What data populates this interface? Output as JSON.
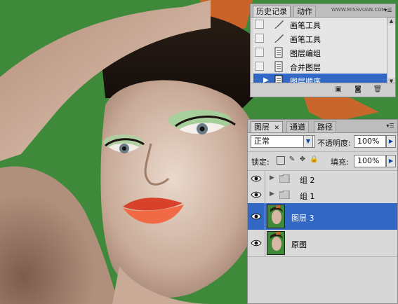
{
  "history_panel": {
    "title_tabs": [
      "历史记录",
      "动作"
    ],
    "watermark": "WWW.MISSVUAN.COM",
    "items": [
      {
        "label": "画笔工具",
        "icon": "brush-icon",
        "selected": false
      },
      {
        "label": "画笔工具",
        "icon": "brush-icon",
        "selected": false
      },
      {
        "label": "图层编组",
        "icon": "history-document-icon",
        "selected": false
      },
      {
        "label": "合并图层",
        "icon": "history-document-icon",
        "selected": false
      },
      {
        "label": "图层顺序",
        "icon": "history-document-icon",
        "selected": true
      }
    ],
    "footer_icons": [
      "new-document-from-state-icon",
      "new-snapshot-icon",
      "trash-icon"
    ]
  },
  "layers_panel": {
    "tabs": [
      {
        "label": "图层",
        "active": true,
        "has_close": true
      },
      {
        "label": "通道",
        "active": false
      },
      {
        "label": "路径",
        "active": false
      }
    ],
    "blend_mode": "正常",
    "opacity_label": "不透明度:",
    "opacity_value": "100%",
    "lock_label": "锁定:",
    "fill_label": "填充:",
    "fill_value": "100%",
    "layers": [
      {
        "name": "组 2",
        "type": "group",
        "visible": true,
        "selected": false
      },
      {
        "name": "组 1",
        "type": "group",
        "visible": true,
        "selected": false
      },
      {
        "name": "图层 3",
        "type": "pixel",
        "visible": true,
        "selected": true
      },
      {
        "name": "原图",
        "type": "pixel",
        "visible": true,
        "selected": false
      }
    ]
  },
  "colors": {
    "background_green": "#3f8a3a",
    "selection_blue": "#3268c3",
    "panel_gray": "#d7d7d7"
  }
}
